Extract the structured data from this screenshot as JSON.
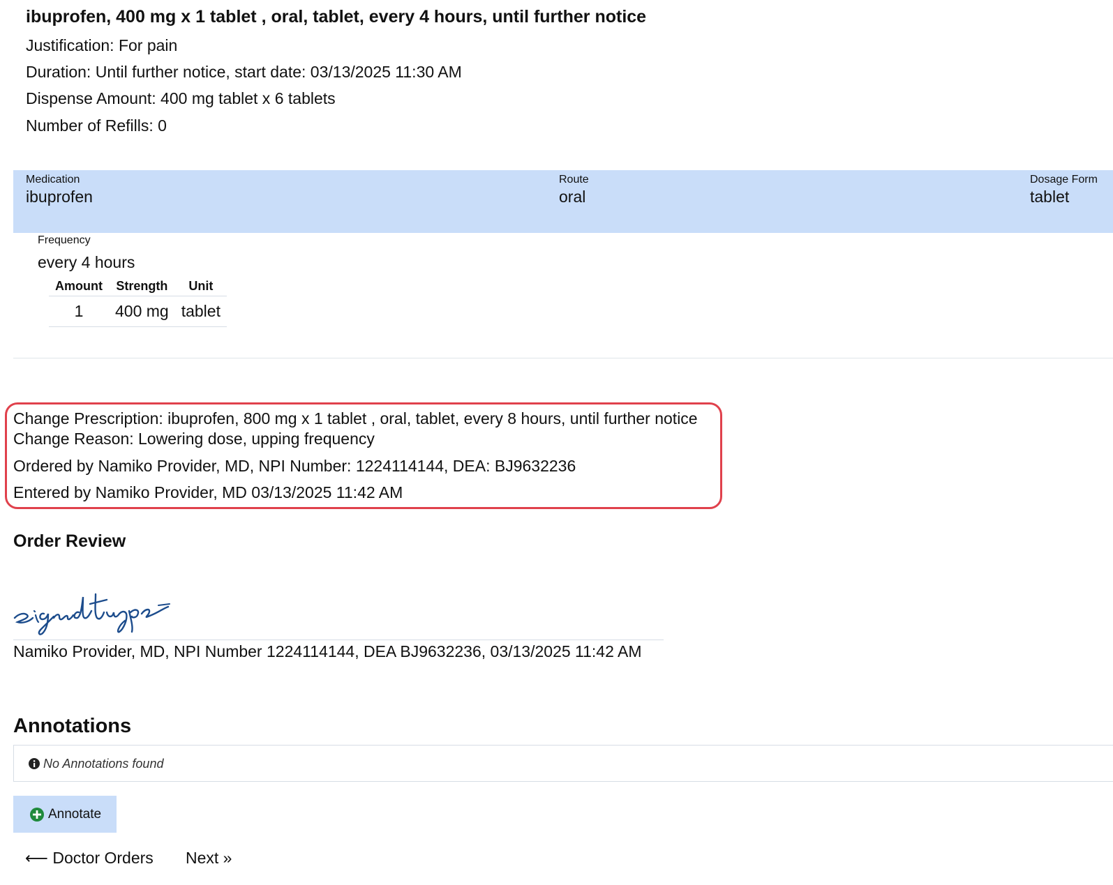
{
  "order": {
    "title": "ibuprofen, 400 mg x 1 tablet , oral, tablet, every 4 hours, until further notice",
    "justification": "Justification: For pain",
    "duration": "Duration: Until further notice, start date: 03/13/2025 11:30 AM",
    "dispense": "Dispense Amount: 400 mg tablet x 6 tablets",
    "refills": "Number of Refills: 0"
  },
  "medication_bar": {
    "medication_label": "Medication",
    "medication_value": "ibuprofen",
    "route_label": "Route",
    "route_value": "oral",
    "form_label": "Dosage Form",
    "form_value": "tablet"
  },
  "frequency": {
    "label": "Frequency",
    "value": "every 4 hours"
  },
  "dose_table": {
    "headers": [
      "Amount",
      "Strength",
      "Unit"
    ],
    "rows": [
      [
        "1",
        "400 mg",
        "tablet"
      ]
    ]
  },
  "change": {
    "prescription": "Change Prescription: ibuprofen, 800 mg x 1 tablet , oral, tablet, every 8 hours, until further notice",
    "reason": "Change Reason: Lowering dose, upping frequency",
    "ordered_by": "Ordered by Namiko Provider, MD, NPI Number: 1224114144, DEA: BJ9632236",
    "entered_by": "Entered by Namiko Provider, MD 03/13/2025 11:42 AM",
    "highlight_color": "#e0414c"
  },
  "order_review": {
    "heading": "Order Review",
    "signature_text": "signature",
    "signer_line": "Namiko Provider, MD, NPI Number 1224114144, DEA BJ9632236, 03/13/2025 11:42 AM"
  },
  "annotations": {
    "heading": "Annotations",
    "empty_message": "No Annotations found",
    "info_icon": "info-circle-icon",
    "annotate_button": "Annotate",
    "annotate_icon": "plus-circle-icon"
  },
  "navigation": {
    "back_label": "⟵ Doctor Orders",
    "next_label": "Next »"
  },
  "colors": {
    "accent_bg": "#c9ddf9",
    "signature_ink": "#1c4c8c",
    "plus_icon": "#1f8a3c"
  }
}
